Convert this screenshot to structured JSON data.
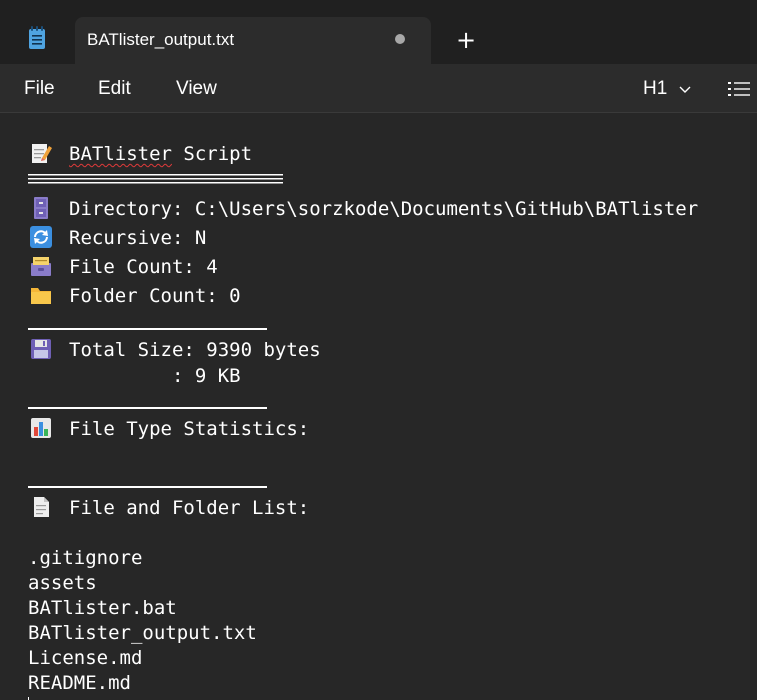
{
  "tab": {
    "title": "BATlister_output.txt"
  },
  "menu": {
    "file": "File",
    "edit": "Edit",
    "view": "View",
    "heading": "H1"
  },
  "content": {
    "title": "BATlister Script",
    "directory": "Directory: C:\\Users\\sorzkode\\Documents\\GitHub\\BATlister",
    "recursive": "Recursive: N",
    "file_count": "File Count: 4",
    "folder_count": "Folder Count: 0",
    "total_size": "Total Size: 9390 bytes",
    "total_size_kb": "         : 9 KB",
    "type_stats": "File Type Statistics:",
    "list_header": "File and Folder List:",
    "files": [
      ".gitignore",
      "assets",
      "BATlister.bat",
      "BATlister_output.txt",
      "License.md",
      "README.md"
    ]
  },
  "icons": {
    "app": "notepad-icon",
    "title": "memo-icon",
    "directory": "file-cabinet-icon",
    "recursive": "repeat-icon",
    "file_count": "card-file-box-icon",
    "folder_count": "folder-icon",
    "total_size": "floppy-disk-icon",
    "type_stats": "bar-chart-icon",
    "list_header": "page-icon"
  },
  "colors": {
    "background": "#272727",
    "tab_bar": "#202020",
    "text": "#ffffff",
    "spellcheck": "#e03a3a"
  }
}
